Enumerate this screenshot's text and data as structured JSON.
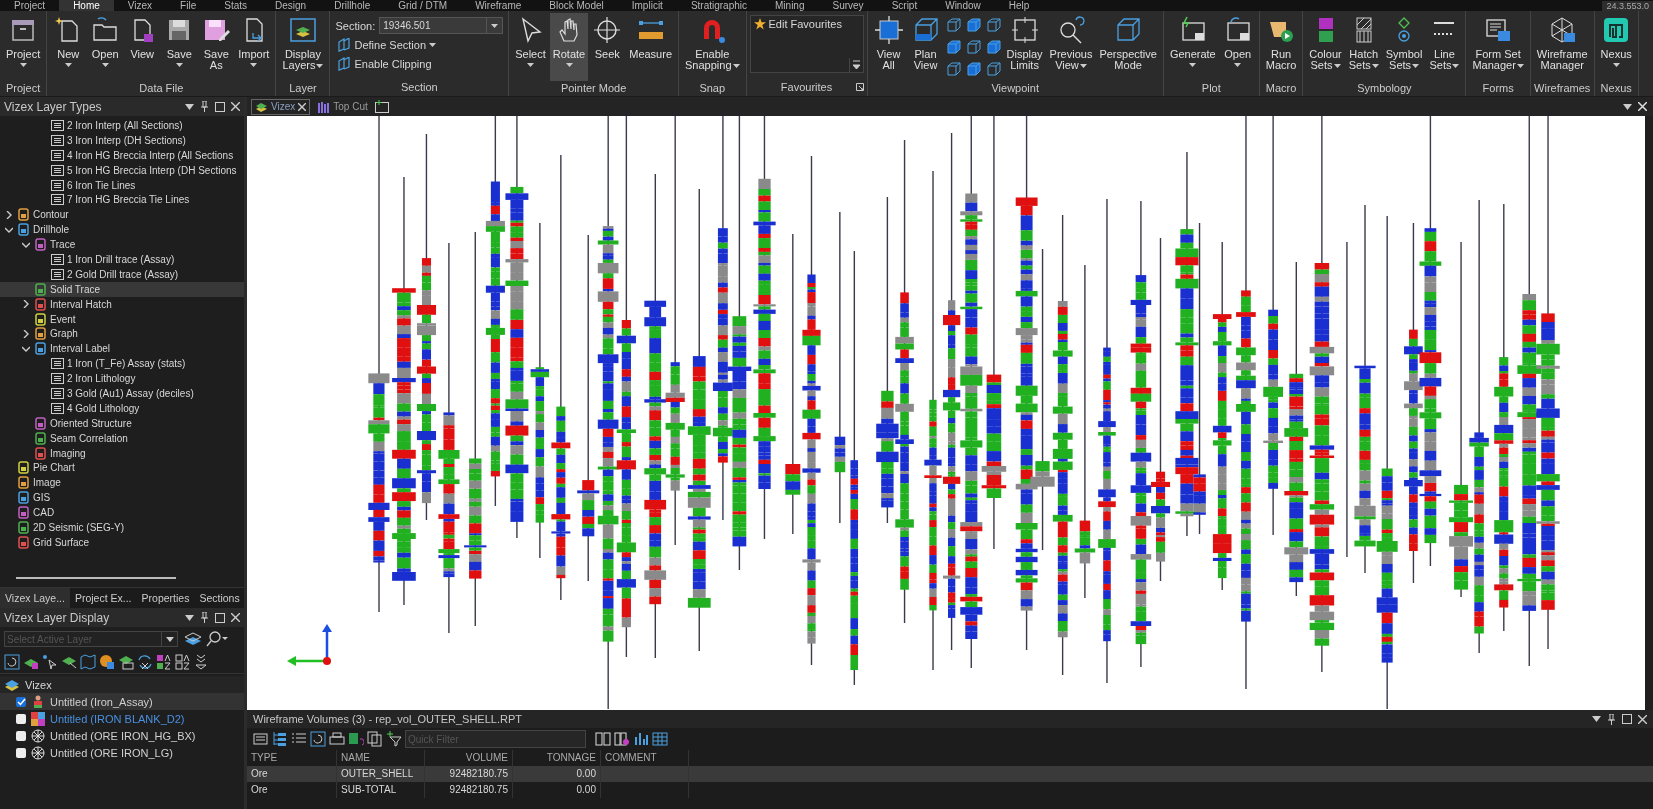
{
  "menu": [
    {
      "label": "Project",
      "selected": false
    },
    {
      "label": "Home",
      "selected": true
    },
    {
      "label": "Vizex",
      "selected": false
    },
    {
      "label": "File",
      "selected": false
    },
    {
      "label": "Stats",
      "selected": false
    },
    {
      "label": "Design",
      "selected": false
    },
    {
      "label": "Drillhole",
      "selected": false
    },
    {
      "label": "Grid / DTM",
      "selected": false
    },
    {
      "label": "Wireframe",
      "selected": false
    },
    {
      "label": "Block Model",
      "selected": false
    },
    {
      "label": "Implicit",
      "selected": false
    },
    {
      "label": "Stratigraphic",
      "selected": false
    },
    {
      "label": "Mining",
      "selected": false
    },
    {
      "label": "Survey",
      "selected": false
    },
    {
      "label": "Script",
      "selected": false
    },
    {
      "label": "Window",
      "selected": false
    },
    {
      "label": "Help",
      "selected": false
    }
  ],
  "version": "24.3.553.0",
  "ribbon": [
    {
      "label": "Project",
      "items": [
        {
          "kind": "large",
          "label": "Project",
          "dropdown": true
        }
      ]
    },
    {
      "label": "Data File",
      "items": [
        {
          "kind": "large",
          "label": "New",
          "dropdown": true
        },
        {
          "kind": "large",
          "label": "Open",
          "dropdown": true
        },
        {
          "kind": "large",
          "label": "View",
          "dropdown": false
        },
        {
          "kind": "large",
          "label": "Save",
          "dropdown": true
        },
        {
          "kind": "large",
          "label": "Save\nAs",
          "dropdown": false
        },
        {
          "kind": "large",
          "label": "Import",
          "dropdown": true
        }
      ]
    },
    {
      "label": "Layer",
      "items": [
        {
          "kind": "large",
          "label": "Display\nLayers",
          "dropdown": true
        }
      ]
    },
    {
      "label": "Section",
      "items": [
        {
          "kind": "section",
          "field_label": "Section:",
          "value": "19346.501",
          "buttons": [
            {
              "label": "Define Section",
              "dropdown": true
            },
            {
              "label": "Enable Clipping",
              "dropdown": false
            }
          ]
        }
      ]
    },
    {
      "label": "Pointer Mode",
      "items": [
        {
          "kind": "large",
          "label": "Select",
          "dropdown": true,
          "selected": false
        },
        {
          "kind": "large",
          "label": "Rotate",
          "dropdown": true,
          "selected": true
        },
        {
          "kind": "large",
          "label": "Seek",
          "dropdown": false,
          "selected": false
        },
        {
          "kind": "large",
          "label": "Measure",
          "dropdown": false,
          "selected": false
        }
      ]
    },
    {
      "label": "Snap",
      "items": [
        {
          "kind": "large",
          "label": "Enable\nSnapping",
          "dropdown": true
        }
      ]
    },
    {
      "label": "Favourites",
      "items": [
        {
          "kind": "favourites",
          "label": "Edit Favourites"
        }
      ]
    },
    {
      "label": "Viewpoint",
      "items": [
        {
          "kind": "large",
          "label": "View\nAll",
          "dropdown": false
        },
        {
          "kind": "large",
          "label": "Plan\nView",
          "dropdown": false
        },
        {
          "kind": "view-grid"
        },
        {
          "kind": "large",
          "label": "Display\nLimits",
          "dropdown": false
        },
        {
          "kind": "large",
          "label": "Previous\nView",
          "dropdown": true
        },
        {
          "kind": "large",
          "label": "Perspective\nMode",
          "dropdown": false
        }
      ]
    },
    {
      "label": "Plot",
      "items": [
        {
          "kind": "large",
          "label": "Generate",
          "dropdown": true
        },
        {
          "kind": "large",
          "label": "Open",
          "dropdown": true
        }
      ]
    },
    {
      "label": "Macro",
      "items": [
        {
          "kind": "large",
          "label": "Run\nMacro",
          "dropdown": false
        }
      ]
    },
    {
      "label": "Symbology",
      "items": [
        {
          "kind": "large",
          "label": "Colour\nSets",
          "dropdown": true
        },
        {
          "kind": "large",
          "label": "Hatch\nSets",
          "dropdown": true
        },
        {
          "kind": "large",
          "label": "Symbol\nSets",
          "dropdown": true
        },
        {
          "kind": "large",
          "label": "Line\nSets",
          "dropdown": true
        }
      ]
    },
    {
      "label": "Forms",
      "items": [
        {
          "kind": "large",
          "label": "Form Set\nManager",
          "dropdown": true
        }
      ]
    },
    {
      "label": "Wireframes",
      "items": [
        {
          "kind": "large",
          "label": "Wireframe\nManager",
          "dropdown": false
        }
      ]
    },
    {
      "label": "Nexus",
      "items": [
        {
          "kind": "large",
          "label": "Nexus",
          "dropdown": true
        }
      ]
    }
  ],
  "layer_types": {
    "title": "Vizex Layer Types",
    "continued_items": [
      {
        "label": "2 Iron Interp (All Sections)",
        "selected": false
      },
      {
        "label": "3 Iron Interp (DH Sections)",
        "selected": false
      },
      {
        "label": "4 Iron HG Breccia Interp (All Sections",
        "selected": false
      },
      {
        "label": "5 Iron HG Breccia Interp (DH Sections",
        "selected": false
      },
      {
        "label": "6 Iron Tie Lines",
        "selected": false
      },
      {
        "label": "7 Iron HG Breccia Tie Lines",
        "selected": false
      }
    ],
    "tree": [
      {
        "label": "Contour",
        "expanded": false,
        "selected": false
      },
      {
        "label": "Drillhole",
        "expanded": true,
        "selected": false,
        "children": [
          {
            "label": "Trace",
            "expanded": true,
            "selected": false,
            "children": [
              {
                "label": "1 Iron Drill trace (Assay)",
                "kind": "list",
                "selected": false
              },
              {
                "label": "2 Gold Drill trace (Assay)",
                "kind": "list",
                "selected": false
              }
            ]
          },
          {
            "label": "Solid Trace",
            "selected": true
          },
          {
            "label": "Interval Hatch",
            "expanded": false,
            "selected": false
          },
          {
            "label": "Event",
            "selected": false
          },
          {
            "label": "Graph",
            "expanded": false,
            "selected": false
          },
          {
            "label": "Interval Label",
            "expanded": true,
            "selected": false,
            "children": [
              {
                "label": "1 Iron (T_Fe) Assay (stats)",
                "kind": "list",
                "selected": false
              },
              {
                "label": "2 Iron Lithology",
                "kind": "list",
                "selected": false
              },
              {
                "label": "3 Gold (Au1) Assay (deciles)",
                "kind": "list",
                "selected": false
              },
              {
                "label": "4 Gold Lithology",
                "kind": "list",
                "selected": false
              }
            ]
          },
          {
            "label": "Oriented Structure",
            "selected": false
          },
          {
            "label": "Seam Correlation",
            "selected": false
          },
          {
            "label": "Imaging",
            "selected": false
          }
        ]
      },
      {
        "label": "Pie Chart",
        "selected": false
      },
      {
        "label": "Image",
        "selected": false
      },
      {
        "label": "GIS",
        "selected": false
      },
      {
        "label": "CAD",
        "selected": false
      },
      {
        "label": "2D Seismic (SEG-Y)",
        "selected": false
      },
      {
        "label": "Grid Surface",
        "selected": false
      }
    ]
  },
  "panel_tabs": [
    {
      "label": "Vizex Laye...",
      "selected": true
    },
    {
      "label": "Project Ex...",
      "selected": false
    },
    {
      "label": "Properties",
      "selected": false
    },
    {
      "label": "Sections",
      "selected": false
    }
  ],
  "layer_display": {
    "title": "Vizex Layer Display",
    "placeholder": "Select Active Layer",
    "root": "Vizex",
    "layers": [
      {
        "label": "Untitled (Iron_Assay)",
        "checked": true,
        "selected": true,
        "active": false
      },
      {
        "label": "Untitled (IRON BLANK_D2)",
        "checked": false,
        "selected": false,
        "active": true
      },
      {
        "label": "Untitled (ORE IRON_HG_BX)",
        "checked": false,
        "selected": false,
        "active": false
      },
      {
        "label": "Untitled (ORE IRON_LG)",
        "checked": false,
        "selected": false,
        "active": false
      }
    ]
  },
  "view_tabs": [
    {
      "label": "Vizex",
      "selected": true
    },
    {
      "label": "Top Cut",
      "selected": false
    }
  ],
  "report": {
    "title": "Wireframe Volumes (3) - rep_vol_OUTER_SHELL.RPT",
    "placeholder": "Quick Filter",
    "columns": [
      "TYPE",
      "NAME",
      "VOLUME",
      "TONNAGE",
      "COMMENT"
    ],
    "rows": [
      {
        "cells": [
          "Ore",
          "OUTER_SHELL",
          "92482180.75",
          "0.00",
          ""
        ],
        "selected": true
      },
      {
        "cells": [
          "Ore",
          "SUB-TOTAL",
          "92482180.75",
          "0.00",
          ""
        ],
        "selected": false
      }
    ]
  }
}
